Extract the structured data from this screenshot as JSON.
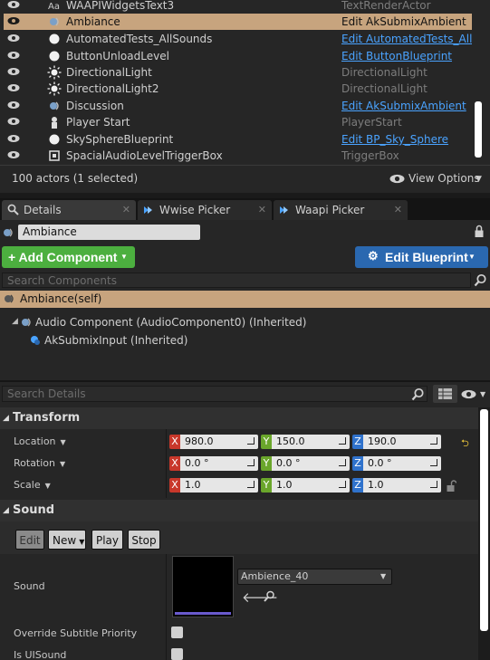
{
  "outliner": {
    "rows": [
      {
        "name": "WAAPIWidgetsText3",
        "type": "TextRenderActor",
        "link": false,
        "icon": "text-render-icon",
        "selected": false
      },
      {
        "name": "Ambiance",
        "type": "Edit AkSubmixAmbient",
        "link": true,
        "icon": "ambient-sound-icon",
        "selected": true
      },
      {
        "name": "AutomatedTests_AllSounds",
        "type": "Edit AutomatedTests_AllS",
        "link": true,
        "icon": "sphere-icon",
        "selected": false
      },
      {
        "name": "ButtonUnloadLevel",
        "type": "Edit ButtonBlueprint",
        "link": true,
        "icon": "sphere-icon",
        "selected": false
      },
      {
        "name": "DirectionalLight",
        "type": "DirectionalLight",
        "link": false,
        "icon": "light-icon",
        "selected": false
      },
      {
        "name": "DirectionalLight2",
        "type": "DirectionalLight",
        "link": false,
        "icon": "light-icon",
        "selected": false
      },
      {
        "name": "Discussion",
        "type": "Edit AkSubmixAmbient",
        "link": true,
        "icon": "ambient-sound-icon",
        "selected": false
      },
      {
        "name": "Player Start",
        "type": "PlayerStart",
        "link": false,
        "icon": "player-start-icon",
        "selected": false
      },
      {
        "name": "SkySphereBlueprint",
        "type": "Edit BP_Sky_Sphere",
        "link": true,
        "icon": "sphere-icon",
        "selected": false
      },
      {
        "name": "SpacialAudioLevelTriggerBox",
        "type": "TriggerBox",
        "link": false,
        "icon": "trigger-box-icon",
        "selected": false
      }
    ],
    "actor_count": "100 actors (1 selected)",
    "view_options": "View Options"
  },
  "tabs": [
    {
      "label": "Details",
      "active": true
    },
    {
      "label": "Wwise Picker",
      "active": false
    },
    {
      "label": "Waapi Picker",
      "active": false
    }
  ],
  "details": {
    "actor_name": "Ambiance",
    "add_component": "+ Add Component",
    "edit_blueprint": "Edit Blueprint",
    "search_components_placeholder": "Search Components",
    "self_label": "Ambiance(self)",
    "components": [
      {
        "label": "Audio Component (AudioComponent0) (Inherited)"
      },
      {
        "label": "AkSubmixInput (Inherited)"
      }
    ],
    "search_details_placeholder": "Search Details",
    "transform": {
      "title": "Transform",
      "location": {
        "label": "Location",
        "x": "980.0",
        "y": "150.0",
        "z": "190.0"
      },
      "rotation": {
        "label": "Rotation",
        "x": "0.0 °",
        "y": "0.0 °",
        "z": "0.0 °"
      },
      "scale": {
        "label": "Scale",
        "x": "1.0",
        "y": "1.0",
        "z": "1.0"
      }
    },
    "sound": {
      "title": "Sound",
      "edit": "Edit",
      "new": "New",
      "play": "Play",
      "stop": "Stop",
      "sound_label": "Sound",
      "asset": "Ambience_40",
      "override_subtitle": "Override Subtitle Priority",
      "is_ui_sound": "Is UISound"
    }
  },
  "colors": {
    "selected_row": "#c7a47e",
    "add_component": "#4caf3f",
    "edit_blueprint": "#2a68b0",
    "link": "#4aa3ff"
  }
}
